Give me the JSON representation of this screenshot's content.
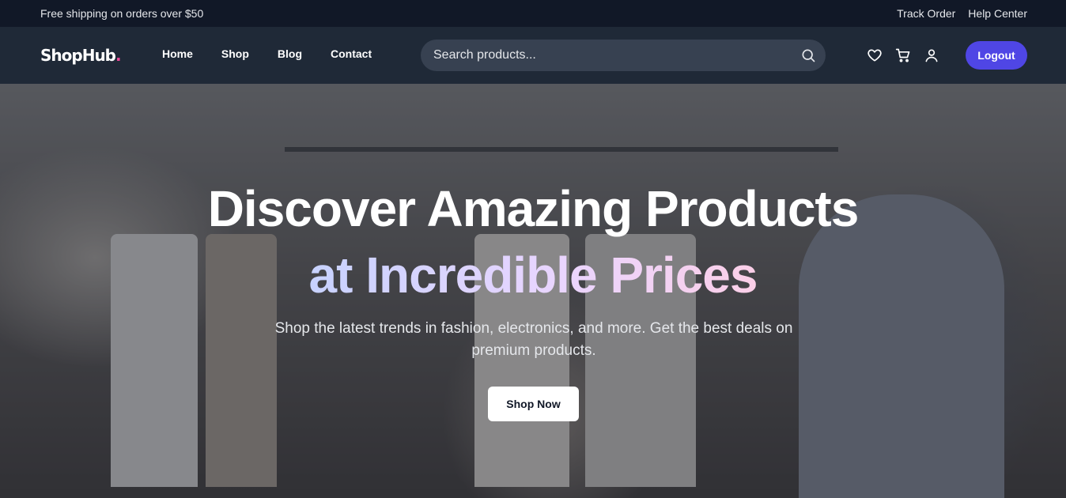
{
  "topbar": {
    "promo": "Free shipping on orders over $50",
    "links": [
      "Track Order",
      "Help Center"
    ]
  },
  "navbar": {
    "logo": "ShopHub",
    "logo_dot": ".",
    "links": [
      "Home",
      "Shop",
      "Blog",
      "Contact"
    ],
    "search_placeholder": "Search products...",
    "icons": [
      "search-icon",
      "heart-icon",
      "cart-icon",
      "user-icon"
    ],
    "logout_label": "Logout",
    "accent": "#4f46e5",
    "logo_dot_color": "#ec4899"
  },
  "hero": {
    "title_line1": "Discover Amazing Products",
    "title_line2": "at Incredible Prices",
    "subtitle": "Shop the latest trends in fashion, electronics, and more. Get the best deals on premium products.",
    "cta_label": "Shop Now"
  }
}
